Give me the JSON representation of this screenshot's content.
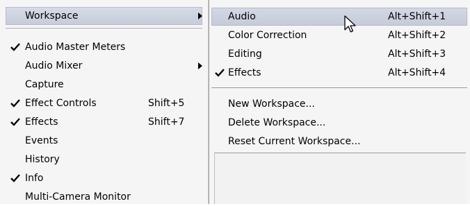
{
  "window_menu": {
    "workspace_label": "Workspace",
    "items": [
      {
        "label": "Audio Master Meters",
        "checked": true,
        "shortcut": ""
      },
      {
        "label": "Audio Mixer",
        "checked": false,
        "shortcut": "",
        "submenu": true
      },
      {
        "label": "Capture",
        "checked": false,
        "shortcut": ""
      },
      {
        "label": "Effect Controls",
        "checked": true,
        "shortcut": "Shift+5"
      },
      {
        "label": "Effects",
        "checked": true,
        "shortcut": "Shift+7"
      },
      {
        "label": "Events",
        "checked": false,
        "shortcut": ""
      },
      {
        "label": "History",
        "checked": false,
        "shortcut": ""
      },
      {
        "label": "Info",
        "checked": true,
        "shortcut": ""
      },
      {
        "label": "Multi-Camera Monitor",
        "checked": false,
        "shortcut": ""
      }
    ]
  },
  "workspace_submenu": {
    "presets": [
      {
        "label": "Audio",
        "shortcut": "Alt+Shift+1",
        "checked": false,
        "highlighted": true
      },
      {
        "label": "Color Correction",
        "shortcut": "Alt+Shift+2",
        "checked": false
      },
      {
        "label": "Editing",
        "shortcut": "Alt+Shift+3",
        "checked": false
      },
      {
        "label": "Effects",
        "shortcut": "Alt+Shift+4",
        "checked": true
      }
    ],
    "actions": [
      {
        "label": "New Workspace..."
      },
      {
        "label": "Delete Workspace..."
      },
      {
        "label": "Reset Current Workspace..."
      }
    ]
  },
  "colors": {
    "menu_bg": "#f5f5f5",
    "highlight": "#cfd4e1"
  }
}
